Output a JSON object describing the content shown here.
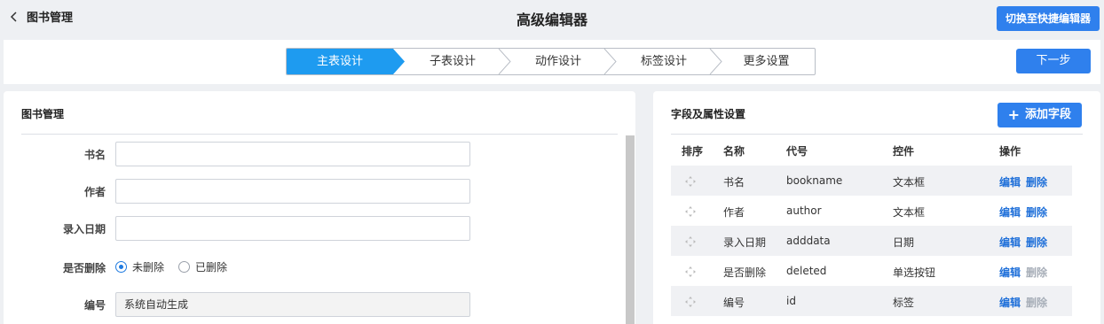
{
  "header": {
    "back_label": "图书管理",
    "title": "高级编辑器",
    "switch_label": "切换至快捷编辑器"
  },
  "steps": {
    "items": [
      {
        "label": "主表设计",
        "active": true
      },
      {
        "label": "子表设计",
        "active": false
      },
      {
        "label": "动作设计",
        "active": false
      },
      {
        "label": "标签设计",
        "active": false
      },
      {
        "label": "更多设置",
        "active": false
      }
    ],
    "next_label": "下一步"
  },
  "form": {
    "title": "图书管理",
    "fields": [
      {
        "label": "书名",
        "value": ""
      },
      {
        "label": "作者",
        "value": ""
      },
      {
        "label": "录入日期",
        "value": ""
      },
      {
        "label": "是否删除",
        "options": [
          "未删除",
          "已删除"
        ],
        "selected": "未删除"
      },
      {
        "label": "编号",
        "value": "系统自动生成"
      }
    ]
  },
  "fields_panel": {
    "title": "字段及属性设置",
    "add_label": "添加字段",
    "columns": [
      "排序",
      "名称",
      "代号",
      "控件",
      "操作"
    ],
    "rows": [
      {
        "name": "书名",
        "code": "bookname",
        "control": "文本框",
        "edit": "编辑",
        "delete": "删除",
        "delete_enabled": true
      },
      {
        "name": "作者",
        "code": "author",
        "control": "文本框",
        "edit": "编辑",
        "delete": "删除",
        "delete_enabled": true
      },
      {
        "name": "录入日期",
        "code": "adddata",
        "control": "日期",
        "edit": "编辑",
        "delete": "删除",
        "delete_enabled": true
      },
      {
        "name": "是否删除",
        "code": "deleted",
        "control": "单选按钮",
        "edit": "编辑",
        "delete": "删除",
        "delete_enabled": false
      },
      {
        "name": "编号",
        "code": "id",
        "control": "标签",
        "edit": "编辑",
        "delete": "删除",
        "delete_enabled": false
      }
    ]
  },
  "colors": {
    "accent": "#2f80ed",
    "step_active": "#1e9bf0",
    "link": "#1e6fd9",
    "link_disabled": "#a7aeb8"
  }
}
